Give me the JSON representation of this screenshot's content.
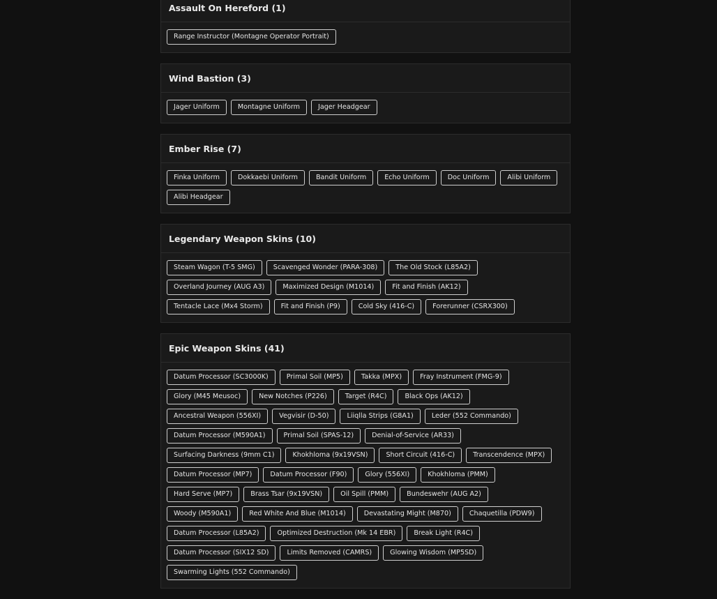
{
  "sections": [
    {
      "title": "Assault On Hereford (1)",
      "items": [
        "Range Instructor (Montagne Operator Portrait)"
      ]
    },
    {
      "title": "Wind Bastion (3)",
      "items": [
        "Jager Uniform",
        "Montagne Uniform",
        "Jager Headgear"
      ]
    },
    {
      "title": "Ember Rise (7)",
      "items": [
        "Finka Uniform",
        "Dokkaebi Uniform",
        "Bandit Uniform",
        "Echo Uniform",
        "Doc Uniform",
        "Alibi Uniform",
        "Alibi Headgear"
      ]
    },
    {
      "title": "Legendary Weapon Skins (10)",
      "items": [
        "Steam Wagon (T-5 SMG)",
        "Scavenged Wonder (PARA-308)",
        "The Old Stock (L85A2)",
        "Overland Journey (AUG A3)",
        "Maximized Design (M1014)",
        "Fit and Finish (AK12)",
        "Tentacle Lace (Mx4 Storm)",
        "Fit and Finish (P9)",
        "Cold Sky (416-C)",
        "Forerunner (CSRX300)"
      ]
    },
    {
      "title": "Epic Weapon Skins (41)",
      "items": [
        "Datum Processor (SC3000K)",
        "Primal Soil (MP5)",
        "Takka (MPX)",
        "Fray Instrument (FMG-9)",
        "Glory (M45 Meusoc)",
        "New Notches (P226)",
        "Target (R4C)",
        "Black Ops (AK12)",
        "Ancestral Weapon (556XI)",
        "Vegvisir (D-50)",
        "Liiqlla Strips (G8A1)",
        "Leder (552 Commando)",
        "Datum Processor (M590A1)",
        "Primal Soil (SPAS-12)",
        "Denial-of-Service (AR33)",
        "Surfacing Darkness (9mm C1)",
        "Khokhloma (9x19VSN)",
        "Short Circuit (416-C)",
        "Transcendence (MPX)",
        "Datum Processor (MP7)",
        "Datum Processor (F90)",
        "Glory (556XI)",
        "Khokhloma (PMM)",
        "Hard Serve (MP7)",
        "Brass Tsar (9x19VSN)",
        "Oil Spill (PMM)",
        "Bundeswehr (AUG A2)",
        "Woody (M590A1)",
        "Red White And Blue (M1014)",
        "Devastating Might (M870)",
        "Chaquetilla (PDW9)",
        "Datum Processor (L85A2)",
        "Optimized Destruction (Mk 14 EBR)",
        "Break Light (R4C)",
        "Datum Processor (SIX12 SD)",
        "Limits Removed (CAMRS)",
        "Glowing Wisdom (MP5SD)",
        "Swarming Lights (552 Commando)"
      ]
    }
  ]
}
